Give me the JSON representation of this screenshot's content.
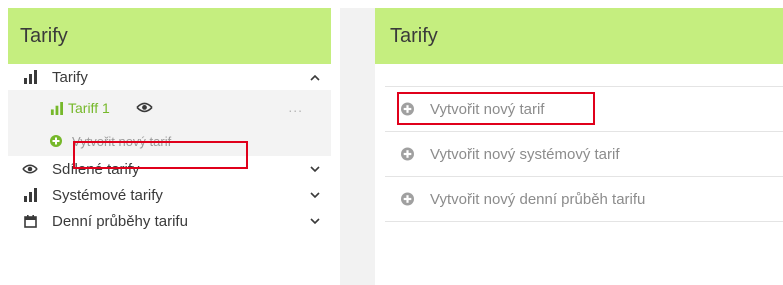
{
  "left_panel": {
    "header_title": "Tarify",
    "items": [
      {
        "label": "Tarify",
        "icon": "bar-chart-icon",
        "expanded": true
      },
      {
        "label": "Sdílené tarify",
        "icon": "shared-eye-icon",
        "expanded": false
      },
      {
        "label": "Systémové tarify",
        "icon": "bar-chart-icon",
        "expanded": false
      },
      {
        "label": "Denní průběhy tarifu",
        "icon": "calendar-icon",
        "expanded": false
      }
    ],
    "sub_items": [
      {
        "label": "Tariff 1",
        "icon": "bar-chart-icon",
        "extra_icon": "shared-eye-icon",
        "menu": "..."
      },
      {
        "label": "Vytvořit nový tarif",
        "icon": "plus-circle-icon"
      }
    ]
  },
  "right_panel": {
    "header_title": "Tarify",
    "actions": [
      {
        "label": "Vytvořit nový tarif",
        "icon": "plus-circle-icon"
      },
      {
        "label": "Vytvořit nový systémový tarif",
        "icon": "plus-circle-icon"
      },
      {
        "label": "Vytvořit nový denní průběh tarifu",
        "icon": "plus-circle-icon"
      }
    ]
  },
  "colors": {
    "header_bg": "#c5ee7f",
    "accent_green": "#76b82a",
    "highlight_red": "#e0001b",
    "muted_text": "#8c8c8c"
  }
}
